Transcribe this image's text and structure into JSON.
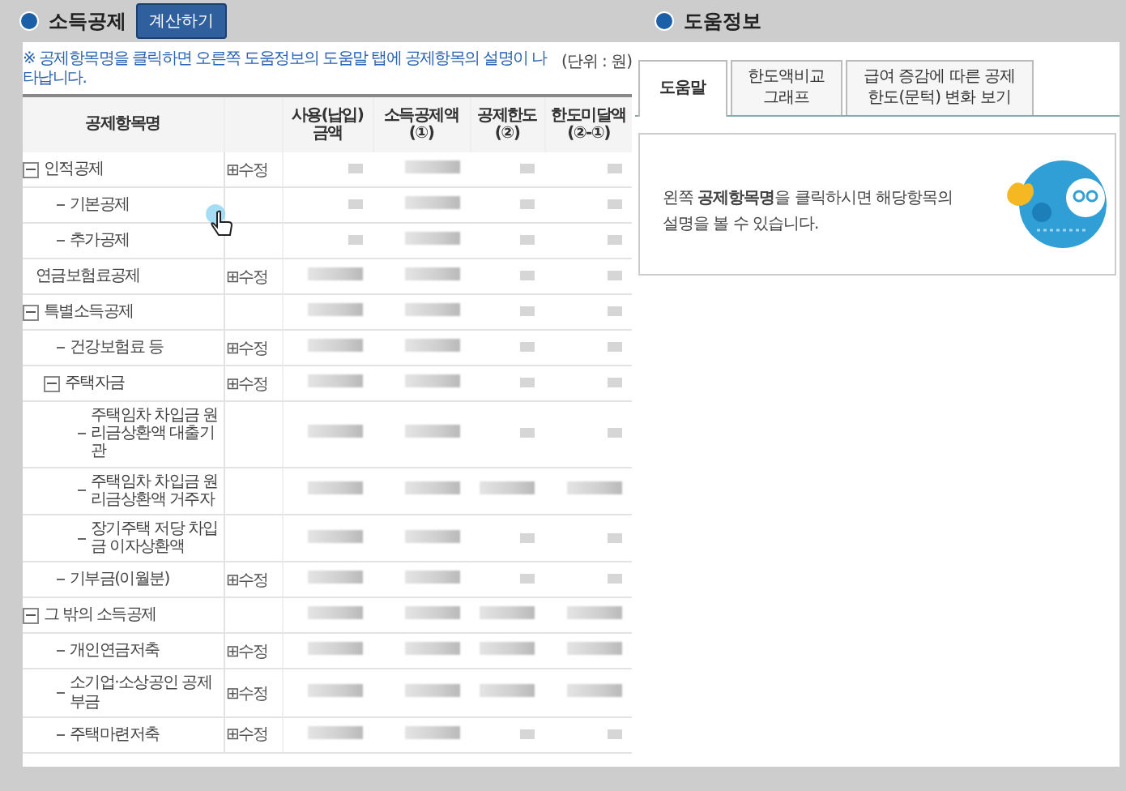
{
  "left": {
    "title": "소득공제",
    "calc_button": "계산하기",
    "notice": "※ 공제항목명을 클릭하면 오른쪽 도움정보의 도움말 탭에 공제항목의 설명이 나타납니다.",
    "unit": "(단위 : 원)",
    "columns": [
      "공제항목명",
      "",
      "사용(납입)\n금액",
      "소득공제액\n(①)",
      "공제한도\n(②)",
      "한도미달액\n(②-①)"
    ],
    "rows": [
      {
        "name": "인적공제",
        "expanded": true,
        "edit": "⊞수정",
        "masked": [
          false,
          true,
          false,
          false
        ],
        "children": [
          {
            "name": "기본공제",
            "masked": [
              false,
              true,
              false,
              false
            ]
          },
          {
            "name": "추가공제",
            "masked": [
              false,
              true,
              false,
              false
            ]
          }
        ]
      },
      {
        "name": "연금보험료공제",
        "edit": "⊞수정",
        "masked": [
          true,
          true,
          false,
          false
        ]
      },
      {
        "name": "특별소득공제",
        "expanded": true,
        "masked": [
          true,
          true,
          false,
          false
        ],
        "children": [
          {
            "name": "건강보험료 등",
            "edit": "⊞수정",
            "masked": [
              true,
              true,
              false,
              false
            ]
          },
          {
            "name": "주택자금",
            "expanded": true,
            "edit": "⊞수정",
            "masked": [
              true,
              true,
              false,
              false
            ],
            "children": [
              {
                "name": "주택임차 차입금 원리금상환액 대출기관",
                "masked": [
                  true,
                  true,
                  false,
                  false
                ]
              },
              {
                "name": "주택임차 차입금 원리금상환액 거주자",
                "masked": [
                  true,
                  true,
                  true,
                  true
                ]
              },
              {
                "name": "장기주택 저당 차입금 이자상환액",
                "masked": [
                  true,
                  true,
                  false,
                  false
                ]
              }
            ]
          },
          {
            "name": "기부금(이월분)",
            "edit": "⊞수정",
            "masked": [
              true,
              true,
              false,
              false
            ]
          }
        ]
      },
      {
        "name": "그 밖의 소득공제",
        "expanded": true,
        "masked": [
          true,
          true,
          true,
          true
        ],
        "children": [
          {
            "name": "개인연금저축",
            "edit": "⊞수정",
            "masked": [
              true,
              true,
              true,
              true
            ]
          },
          {
            "name": "소기업·소상공인 공제부금",
            "edit": "⊞수정",
            "masked": [
              true,
              true,
              true,
              true
            ]
          },
          {
            "name": "주택마련저축",
            "edit": "⊞수정",
            "masked": [
              true,
              true,
              false,
              false
            ]
          }
        ]
      }
    ]
  },
  "right": {
    "title": "도움정보",
    "tabs": [
      {
        "label": "도움말",
        "selected": true
      },
      {
        "label": "한도액비교\n그래프",
        "selected": false
      },
      {
        "label": "급여 증감에 따른 공제\n한도(문턱) 변화 보기",
        "selected": false
      }
    ],
    "help_text": "왼쪽 **공제항목명**을 클릭하시면 해당항목의\n설명을 볼 수 있습니다."
  }
}
